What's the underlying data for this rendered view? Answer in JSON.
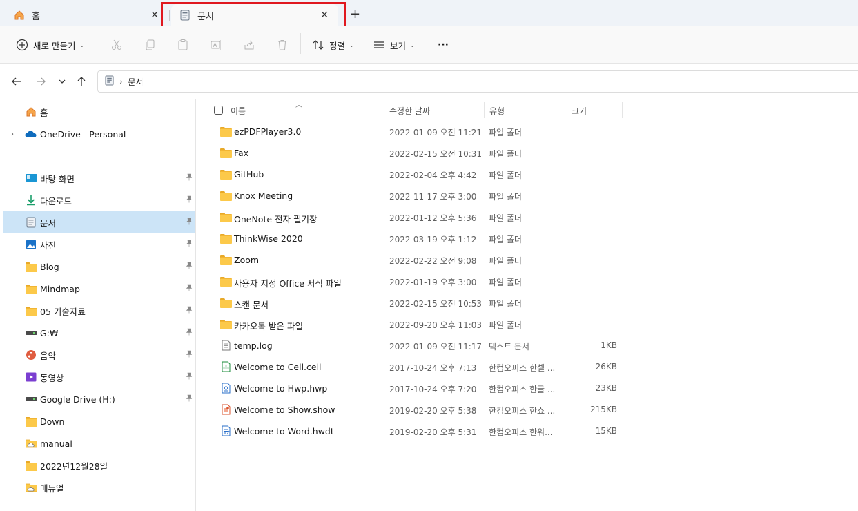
{
  "tabs": [
    {
      "label": "홈",
      "icon": "home-icon"
    },
    {
      "label": "문서",
      "icon": "documents-icon",
      "active": true
    }
  ],
  "tab_add_label": "+",
  "tab_close_label": "✕",
  "toolbar": {
    "new_label": "새로 만들기",
    "sort_label": "정렬",
    "view_label": "보기",
    "more_label": "···"
  },
  "address": {
    "crumbs": [
      "문서"
    ]
  },
  "sidebar": {
    "top": [
      {
        "label": "홈",
        "icon": "home-icon"
      },
      {
        "label": "OneDrive - Personal",
        "icon": "onedrive-icon"
      }
    ],
    "pinned": [
      {
        "label": "바탕 화면",
        "icon": "desktop-icon",
        "pinned": true
      },
      {
        "label": "다운로드",
        "icon": "download-icon",
        "pinned": true
      },
      {
        "label": "문서",
        "icon": "documents-icon",
        "pinned": true,
        "active": true
      },
      {
        "label": "사진",
        "icon": "pictures-icon",
        "pinned": true
      },
      {
        "label": "Blog",
        "icon": "folder-icon",
        "pinned": true
      },
      {
        "label": "Mindmap",
        "icon": "folder-icon",
        "pinned": true
      },
      {
        "label": "05 기술자료",
        "icon": "folder-icon",
        "pinned": true
      },
      {
        "label": "G:₩",
        "icon": "drive-icon",
        "pinned": true
      },
      {
        "label": "음악",
        "icon": "music-icon",
        "pinned": true
      },
      {
        "label": "동영상",
        "icon": "video-icon",
        "pinned": true
      },
      {
        "label": "Google Drive (H:)",
        "icon": "drive-icon",
        "pinned": true
      },
      {
        "label": "Down",
        "icon": "folder-icon",
        "pinned": false
      },
      {
        "label": "manual",
        "icon": "cloud-folder-icon",
        "pinned": false
      },
      {
        "label": "2022년12월28일",
        "icon": "folder-icon",
        "pinned": false
      },
      {
        "label": "매뉴얼",
        "icon": "cloud-folder-icon",
        "pinned": false
      }
    ]
  },
  "columns": {
    "name": "이름",
    "date": "수정한 날짜",
    "type": "유형",
    "size": "크기"
  },
  "files": [
    {
      "name": "ezPDFPlayer3.0",
      "date": "2022-01-09 오전 11:21",
      "type": "파일 폴더",
      "size": "",
      "icon": "folder-icon"
    },
    {
      "name": "Fax",
      "date": "2022-02-15 오전 10:31",
      "type": "파일 폴더",
      "size": "",
      "icon": "folder-icon"
    },
    {
      "name": "GitHub",
      "date": "2022-02-04 오후 4:42",
      "type": "파일 폴더",
      "size": "",
      "icon": "folder-icon"
    },
    {
      "name": "Knox Meeting",
      "date": "2022-11-17 오후 3:00",
      "type": "파일 폴더",
      "size": "",
      "icon": "folder-icon"
    },
    {
      "name": "OneNote 전자 필기장",
      "date": "2022-01-12 오후 5:36",
      "type": "파일 폴더",
      "size": "",
      "icon": "folder-icon"
    },
    {
      "name": "ThinkWise 2020",
      "date": "2022-03-19 오후 1:12",
      "type": "파일 폴더",
      "size": "",
      "icon": "folder-icon"
    },
    {
      "name": "Zoom",
      "date": "2022-02-22 오전 9:08",
      "type": "파일 폴더",
      "size": "",
      "icon": "folder-icon"
    },
    {
      "name": "사용자 지정 Office 서식 파일",
      "date": "2022-01-19 오후 3:00",
      "type": "파일 폴더",
      "size": "",
      "icon": "folder-icon"
    },
    {
      "name": "스캔 문서",
      "date": "2022-02-15 오전 10:53",
      "type": "파일 폴더",
      "size": "",
      "icon": "folder-icon"
    },
    {
      "name": "카카오톡 받은 파일",
      "date": "2022-09-20 오후 11:03",
      "type": "파일 폴더",
      "size": "",
      "icon": "folder-icon"
    },
    {
      "name": "temp.log",
      "date": "2022-01-09 오전 11:17",
      "type": "텍스트 문서",
      "size": "1KB",
      "icon": "text-file-icon"
    },
    {
      "name": "Welcome to Cell.cell",
      "date": "2017-10-24 오후 7:13",
      "type": "한컴오피스 한셀 ...",
      "size": "26KB",
      "icon": "cell-file-icon"
    },
    {
      "name": "Welcome to Hwp.hwp",
      "date": "2017-10-24 오후 7:20",
      "type": "한컴오피스 한글 ...",
      "size": "23KB",
      "icon": "hwp-file-icon"
    },
    {
      "name": "Welcome to Show.show",
      "date": "2019-02-20 오후 5:38",
      "type": "한컴오피스 한쇼 ...",
      "size": "215KB",
      "icon": "show-file-icon"
    },
    {
      "name": "Welcome to Word.hwdt",
      "date": "2019-02-20 오후 5:31",
      "type": "한컴오피스 한워...",
      "size": "15KB",
      "icon": "word-file-icon"
    }
  ]
}
